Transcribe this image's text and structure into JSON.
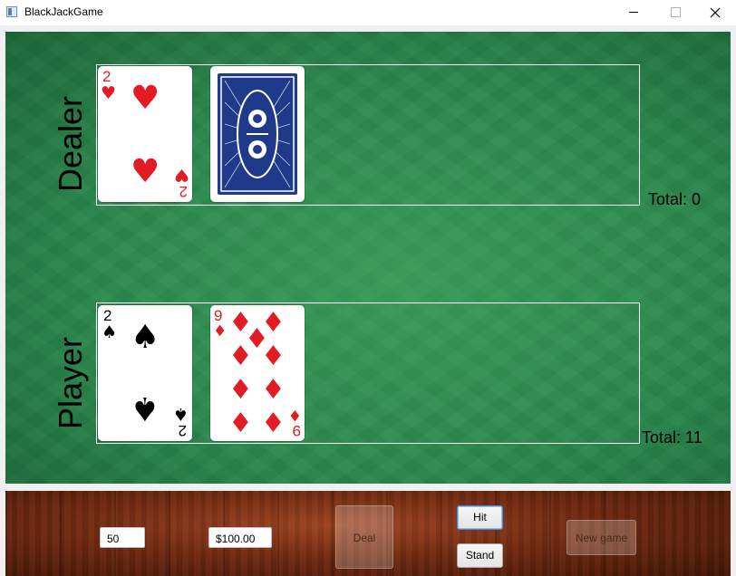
{
  "window": {
    "title": "BlackJackGame",
    "icon": "app-window-icon"
  },
  "dealer": {
    "label": "Dealer",
    "total": "Total: 0",
    "cards": [
      {
        "rank": "2",
        "suit": "hearts",
        "face_up": true
      },
      {
        "rank": "",
        "suit": "",
        "face_up": false
      }
    ]
  },
  "player": {
    "label": "Player",
    "total": "Total: 11",
    "cards": [
      {
        "rank": "2",
        "suit": "spades",
        "face_up": true
      },
      {
        "rank": "9",
        "suit": "diamonds",
        "face_up": true
      }
    ]
  },
  "controls": {
    "bet_value": "50",
    "bank_value": "$100.00",
    "deal_label": "Deal",
    "hit_label": "Hit",
    "stand_label": "Stand",
    "new_game_label": "New game"
  },
  "colors": {
    "felt": "#2b8a4e",
    "red_suit": "#e31b23",
    "black_suit": "#000000",
    "card_back": "#1f3a8a"
  }
}
